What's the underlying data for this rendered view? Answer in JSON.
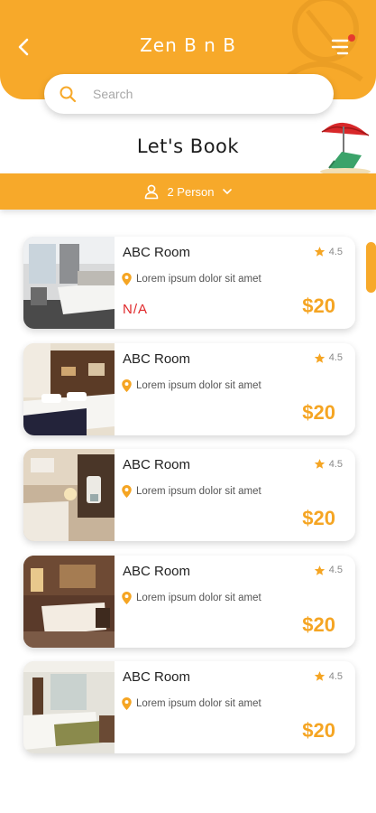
{
  "header": {
    "title": "Zen B n B"
  },
  "search": {
    "placeholder": "Search"
  },
  "heading": "Let's Book",
  "guests": {
    "label": "2 Person"
  },
  "colors": {
    "accent": "#f7a92a",
    "price": "#f5a523",
    "na": "#e0282a"
  },
  "rooms": [
    {
      "name": "ABC Room",
      "rating": "4.5",
      "location": "Lorem ipsum dolor sit amet",
      "status": "N/A",
      "price": "$20"
    },
    {
      "name": "ABC Room",
      "rating": "4.5",
      "location": "Lorem ipsum dolor sit amet",
      "status": "",
      "price": "$20"
    },
    {
      "name": "ABC Room",
      "rating": "4.5",
      "location": "Lorem ipsum dolor sit amet",
      "status": "",
      "price": "$20"
    },
    {
      "name": "ABC Room",
      "rating": "4.5",
      "location": "Lorem ipsum dolor sit amet",
      "status": "",
      "price": "$20"
    },
    {
      "name": "ABC Room",
      "rating": "4.5",
      "location": "Lorem ipsum dolor sit amet",
      "status": "",
      "price": "$20"
    }
  ]
}
